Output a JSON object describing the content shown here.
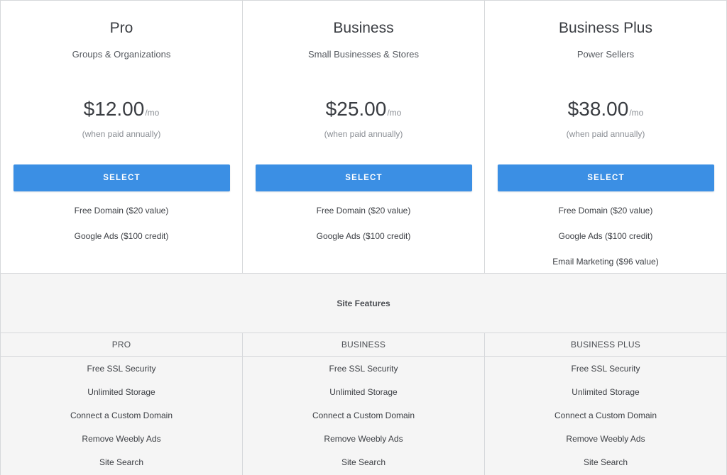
{
  "plans": [
    {
      "name": "Pro",
      "subtitle": "Groups & Organizations",
      "price": "$12.00",
      "period": "/mo",
      "note": "(when paid annually)",
      "button": "SELECT",
      "perks": [
        "Free Domain ($20 value)",
        "Google Ads ($100 credit)"
      ]
    },
    {
      "name": "Business",
      "subtitle": "Small Businesses & Stores",
      "price": "$25.00",
      "period": "/mo",
      "note": "(when paid annually)",
      "button": "SELECT",
      "perks": [
        "Free Domain ($20 value)",
        "Google Ads ($100 credit)"
      ]
    },
    {
      "name": "Business Plus",
      "subtitle": "Power Sellers",
      "price": "$38.00",
      "period": "/mo",
      "note": "(when paid annually)",
      "button": "SELECT",
      "perks": [
        "Free Domain ($20 value)",
        "Google Ads ($100 credit)",
        "Email Marketing ($96 value)"
      ]
    }
  ],
  "features": {
    "title": "Site Features",
    "columns": [
      {
        "header": "PRO",
        "items": [
          "Free SSL Security",
          "Unlimited Storage",
          "Connect a Custom Domain",
          "Remove Weebly Ads",
          "Site Search"
        ]
      },
      {
        "header": "BUSINESS",
        "items": [
          "Free SSL Security",
          "Unlimited Storage",
          "Connect a Custom Domain",
          "Remove Weebly Ads",
          "Site Search"
        ]
      },
      {
        "header": "BUSINESS PLUS",
        "items": [
          "Free SSL Security",
          "Unlimited Storage",
          "Connect a Custom Domain",
          "Remove Weebly Ads",
          "Site Search"
        ]
      }
    ]
  },
  "colors": {
    "accent": "#3b8fe4",
    "border": "#d6d8db",
    "features_bg": "#f5f5f5"
  }
}
